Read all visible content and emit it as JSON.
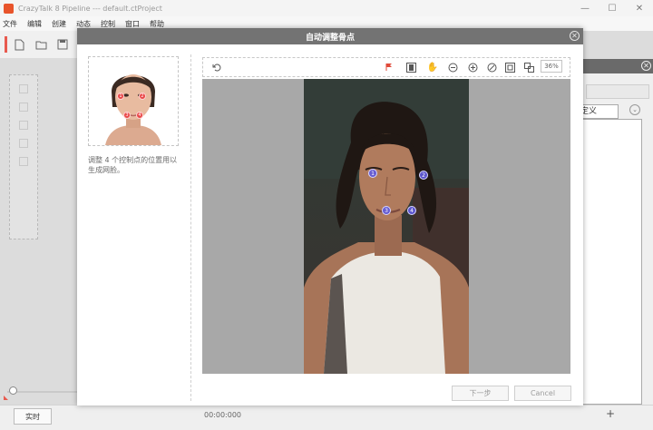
{
  "app": {
    "title": "CrazyTalk 8 Pipeline  ---  default.ctProject",
    "controls": [
      "—",
      "☐",
      "✕"
    ]
  },
  "menu": [
    "文件",
    "编辑",
    "创建",
    "动态",
    "控制",
    "窗口",
    "帮助"
  ],
  "bottom": {
    "realtime_label": "实时",
    "time": "00:00:000"
  },
  "right_panel": {
    "tab_label": "定义",
    "add_symbol": "+"
  },
  "dialog": {
    "title": "自动调整骨点",
    "close": "✕",
    "instruction": "调整 4 个控制点的位置用以生成网脸。",
    "zoom": "36%",
    "next_label": "下一步",
    "cancel_label": "Cancel"
  },
  "control_points": {
    "ref": [
      "1",
      "2",
      "3",
      "4"
    ],
    "photo": [
      "1",
      "2",
      "3",
      "4"
    ]
  },
  "colors": {
    "accent": "#e85a4f",
    "title_bar": "#737373",
    "control_point": "#5f5adc"
  }
}
